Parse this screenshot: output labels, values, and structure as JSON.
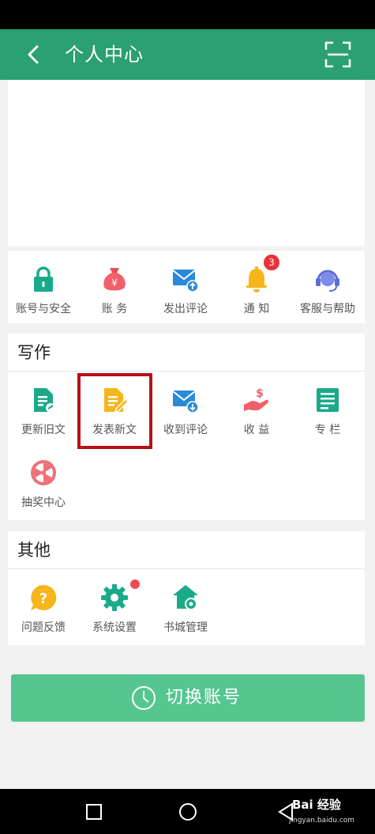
{
  "header": {
    "title": "个人中心",
    "background": "#2ba072"
  },
  "account_section": {
    "items": [
      {
        "label": "账号与安全",
        "icon": "lock-icon"
      },
      {
        "label": "账  务",
        "icon": "money-bag-icon"
      },
      {
        "label": "发出评论",
        "icon": "mail-send-icon"
      },
      {
        "label": "通  知",
        "icon": "bell-icon",
        "badge": "3"
      },
      {
        "label": "客服与帮助",
        "icon": "headset-icon"
      }
    ]
  },
  "writing_section": {
    "title": "写作",
    "items": [
      {
        "label": "更新旧文",
        "icon": "document-edit-icon"
      },
      {
        "label": "发表新文",
        "icon": "compose-icon"
      },
      {
        "label": "收到评论",
        "icon": "mail-receive-icon"
      },
      {
        "label": "收  益",
        "icon": "hand-money-icon"
      },
      {
        "label": "专  栏",
        "icon": "column-icon"
      },
      {
        "label": "抽奖中心",
        "icon": "lottery-wheel-icon"
      }
    ]
  },
  "other_section": {
    "title": "其他",
    "items": [
      {
        "label": "问题反馈",
        "icon": "question-icon"
      },
      {
        "label": "系统设置",
        "icon": "gear-icon"
      },
      {
        "label": "书城管理",
        "icon": "house-gear-icon"
      }
    ]
  },
  "switch_account": {
    "label": "切换账号",
    "color": "#55c690"
  },
  "watermark": {
    "brand": "Bai 经验",
    "url": "jingyan.baidu.com"
  },
  "colors": {
    "accent_green": "#2ba072",
    "highlight_red": "#b51217",
    "badge_red": "#e8323a"
  }
}
